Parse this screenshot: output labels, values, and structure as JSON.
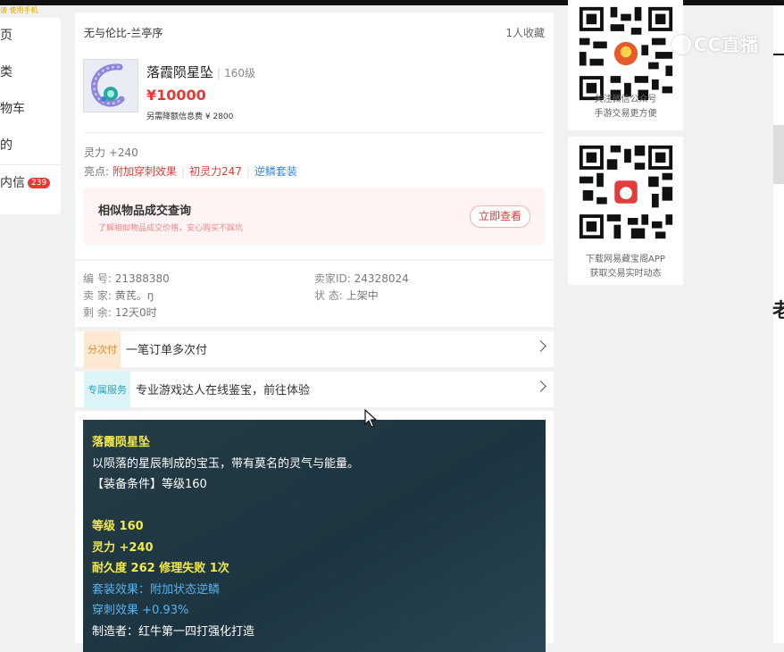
{
  "top_tip": "请 使用手机",
  "sidebar": {
    "items": [
      {
        "label": "页"
      },
      {
        "label": "类"
      },
      {
        "label": "物车"
      },
      {
        "label": "的"
      },
      {
        "label": "内信",
        "badge": "239"
      }
    ]
  },
  "store": {
    "name": "无与伦比-兰亭序",
    "favorites": "1人收藏"
  },
  "item": {
    "title": "落霞陨星坠",
    "level": "160级",
    "price": "¥10000",
    "fee": "另需降额信息费 ¥ 2800",
    "attr": "灵力 +240",
    "highlights_label": "亮点:",
    "highlights": [
      "附加穿刺效果",
      "初灵力247",
      "逆鳞套装"
    ]
  },
  "similar": {
    "title": "相似物品成交查询",
    "subtitle": "了解相似物品成交价格，安心购买不踩坑",
    "button": "立即查看"
  },
  "info": {
    "id_label": "编 号:",
    "id_value": "21388380",
    "seller_id_label": "卖家ID:",
    "seller_id_value": "24328024",
    "seller_label": "卖 家:",
    "seller_value": "黄芪。ŋ",
    "status_label": "状 态:",
    "status_value": "上架中",
    "remaining_label": "剩 余:",
    "remaining_value": "12天0时"
  },
  "installment": {
    "tag": "分次付",
    "text": "一笔订单多次付"
  },
  "service": {
    "tag": "专属服务",
    "text": "专业游戏达人在线鉴宝，前往体验"
  },
  "description": {
    "name": "落霞陨星坠",
    "flavor": "以陨落的星辰制成的宝玉，带有莫名的灵气与能量。",
    "requirement": "【装备条件】等级160",
    "stat_level": "等级 160",
    "stat_ling": "灵力 +240",
    "durability": "耐久度 262 修理失败 1次",
    "set_effect": "套装效果：附加状态逆鳞",
    "pierce": "穿刺效果 +0.93%",
    "maker": "制造者：红牛第一四打强化打造"
  },
  "qr1": {
    "line1": "关注微信公众号",
    "line2": "手游交易更方便"
  },
  "qr2": {
    "line1": "下载网易藏宝阁APP",
    "line2": "获取交易实时动态"
  },
  "overlay": {
    "logo": "CC直播",
    "edge_glyph": "老"
  }
}
